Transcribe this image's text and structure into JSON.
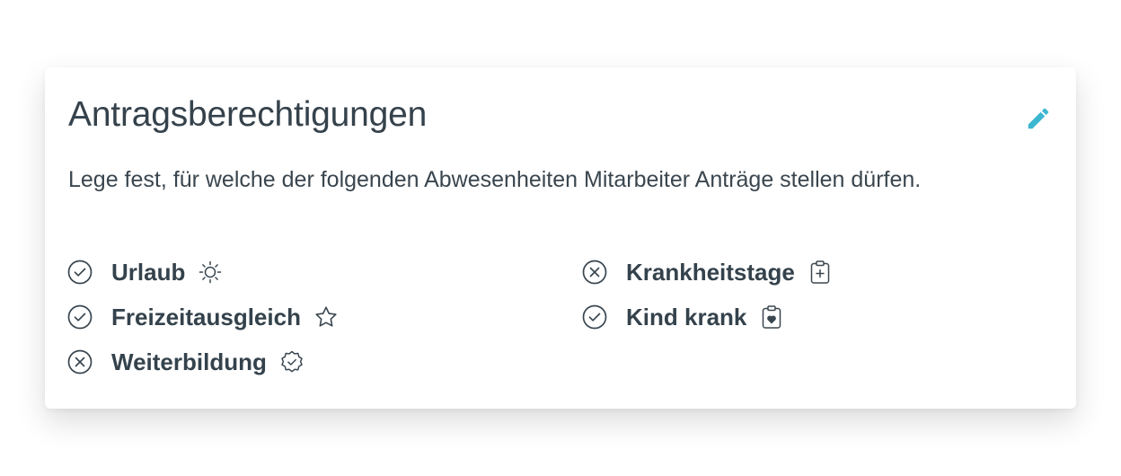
{
  "card": {
    "title": "Antragsberechtigungen",
    "description": "Lege fest, für welche der folgenden Abwesenheiten Mitarbeiter Anträge stellen dürfen.",
    "edit_icon": "pencil-icon",
    "accent_color": "#3db6d0"
  },
  "permissions": [
    {
      "label": "Urlaub",
      "allowed": true,
      "status_icon": "check-circle-icon",
      "type_icon": "sun-icon"
    },
    {
      "label": "Freizeitausgleich",
      "allowed": true,
      "status_icon": "check-circle-icon",
      "type_icon": "star-icon"
    },
    {
      "label": "Weiterbildung",
      "allowed": false,
      "status_icon": "x-circle-icon",
      "type_icon": "badge-check-icon"
    },
    {
      "label": "Krankheitstage",
      "allowed": false,
      "status_icon": "x-circle-icon",
      "type_icon": "clipboard-plus-icon"
    },
    {
      "label": "Kind krank",
      "allowed": true,
      "status_icon": "check-circle-icon",
      "type_icon": "clipboard-heart-icon"
    }
  ]
}
